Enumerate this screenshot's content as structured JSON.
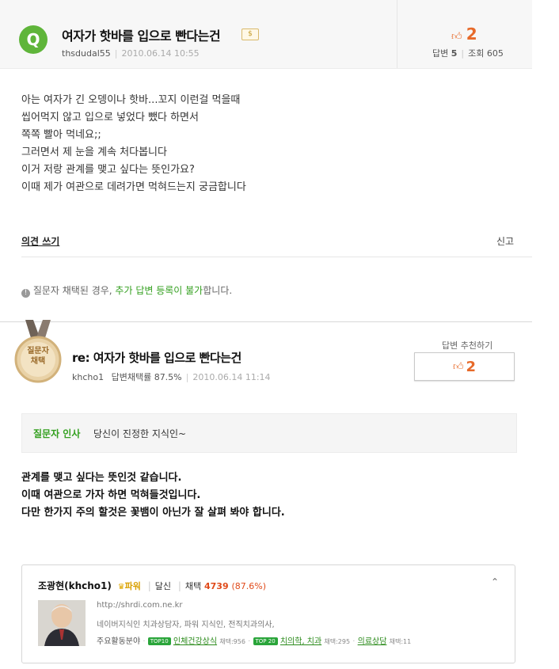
{
  "question": {
    "badge": "Q",
    "title": "여자가 핫바를 입으로 빤다는건",
    "coin": "$",
    "author": "thsdudal55",
    "date": "2010.06.14 10:55",
    "likes": "2",
    "answers_label": "답변",
    "answers_count": "5",
    "views_label": "조회",
    "views_count": "605",
    "body_lines": [
      "아는 여자가 긴 오뎅이나 핫바...꼬지 이런걸 먹을때",
      "씹어먹지 않고 입으로 넣었다 뺐다 하면서",
      "쪽쪽 빨아 먹네요;;",
      "그러면서 제 눈을 계속 처다봅니다",
      "이거 저랑 관계를 맺고 싶다는 뜻인가요?",
      "이때 제가 여관으로 데려가면 먹혀드는지 궁금합니다"
    ],
    "comment_link": "의견 쓰기",
    "report_link": "신고"
  },
  "notice": {
    "prefix": "질문자 채택된 경우, ",
    "highlight": "추가 답변 등록이 불가",
    "suffix": "합니다."
  },
  "answer": {
    "medal_line1": "질문자",
    "medal_line2": "채택",
    "title": "re: 여자가 핫바를 입으로 빤다는건",
    "author": "khcho1",
    "rate": "답변채택률 87.5%",
    "date": "2010.06.14 11:14",
    "recommend_label": "답변 추천하기",
    "recommend_count": "2",
    "greeting_label": "질문자 인사",
    "greeting_text": "당신이 진정한 지식인~",
    "body_lines": [
      "관계를 맺고 싶다는 뜻인것 같습니다.",
      "이때 여관으로 가자 하면 먹혀들것입니다.",
      "다만 한가지 주의 할것은 꽃뱀이 아닌가 잘 살펴 봐야 합니다."
    ]
  },
  "profile": {
    "name": "조광현(khcho1)",
    "grade": "파워",
    "level": "달신",
    "adopt_label": "채택",
    "adopt_count": "4739",
    "adopt_pct": "(87.6%)",
    "url": "http://shrdi.com.ne.kr",
    "desc": "네이버지식인 치과상담자, 파워 지식인, 전직치과의사,",
    "areas_label": "주요활동분야",
    "areas": [
      {
        "rank": "TOP10",
        "name": "인체건강상식",
        "count": "채택:956"
      },
      {
        "rank": "TOP 20",
        "name": "치의학, 치과",
        "count": "채택:295"
      },
      {
        "rank": "",
        "name": "의료상담",
        "count": "채택:11"
      }
    ]
  },
  "colors": {
    "accent_green": "#34a020",
    "like_orange": "#e76a2a",
    "badge_green": "#5fb53a"
  }
}
